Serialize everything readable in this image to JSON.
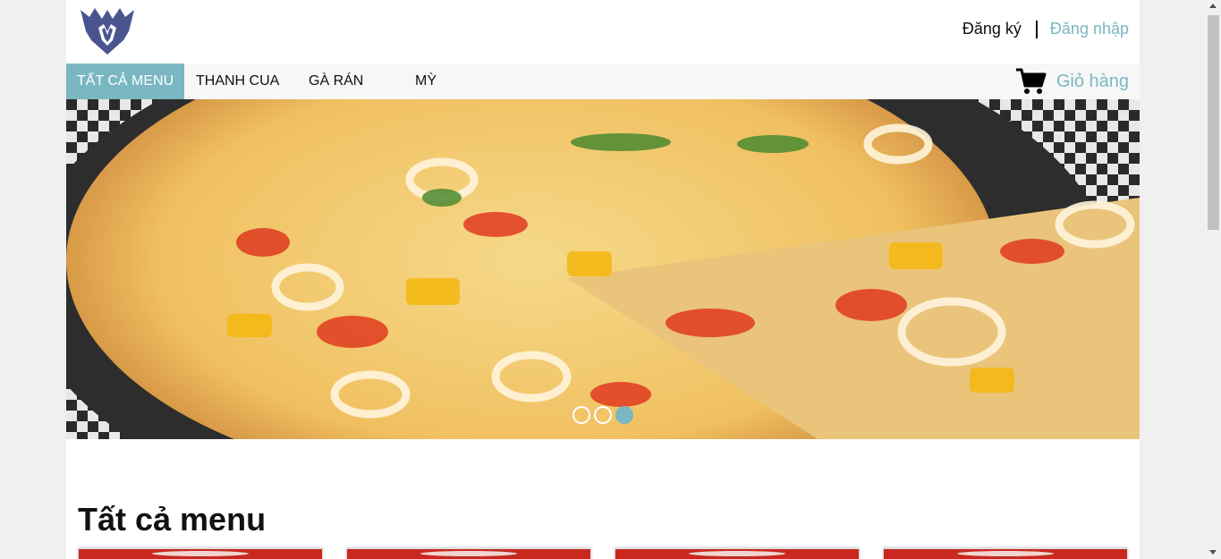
{
  "header": {
    "logo_icon": "crest-logo-icon",
    "register_label": "Đăng ký",
    "login_label": "Đăng nhập"
  },
  "nav": {
    "items": [
      {
        "label": "TẤT CẢ MENU",
        "active": true
      },
      {
        "label": "THANH CUA",
        "active": false
      },
      {
        "label": "GÀ RÁN",
        "active": false
      },
      {
        "label": "MỲ",
        "active": false
      }
    ],
    "cart_icon": "shopping-cart-icon",
    "cart_label": "Giỏ hàng"
  },
  "slider": {
    "image": "pizza-banner-image",
    "slide_count": 3,
    "active_slide": 3
  },
  "main": {
    "section_title": "Tất cả menu"
  },
  "colors": {
    "accent": "#7ab7c2",
    "text": "#111111",
    "page_bg": "#f0f0f0"
  }
}
